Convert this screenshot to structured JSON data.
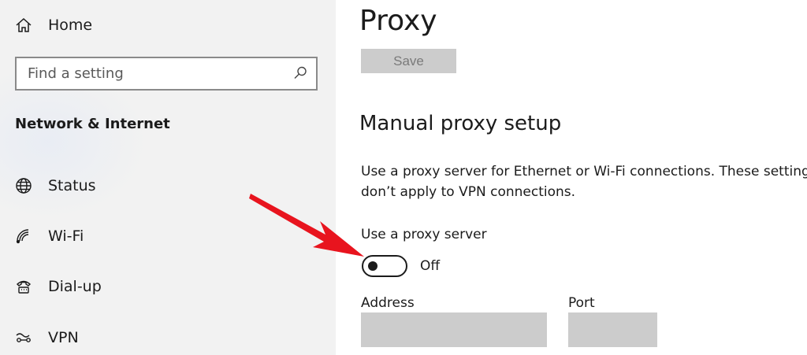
{
  "sidebar": {
    "home_label": "Home",
    "search_placeholder": "Find a setting",
    "section_title": "Network & Internet",
    "items": [
      {
        "label": "Status",
        "icon": "globe-icon"
      },
      {
        "label": "Wi-Fi",
        "icon": "wifi-icon"
      },
      {
        "label": "Dial-up",
        "icon": "phone-icon"
      },
      {
        "label": "VPN",
        "icon": "vpn-icon"
      }
    ]
  },
  "main": {
    "title": "Proxy",
    "save_label": "Save",
    "section_heading": "Manual proxy setup",
    "description_line1": "Use a proxy server for Ethernet or Wi-Fi connections. These settings",
    "description_line2": "don’t apply to VPN connections.",
    "toggle_label": "Use a proxy server",
    "toggle_state": "Off",
    "address_label": "Address",
    "port_label": "Port"
  },
  "colors": {
    "sidebar_bg": "#f2f2f2",
    "disabled_fill": "#cccccc",
    "annotation_arrow": "#e8141e"
  }
}
